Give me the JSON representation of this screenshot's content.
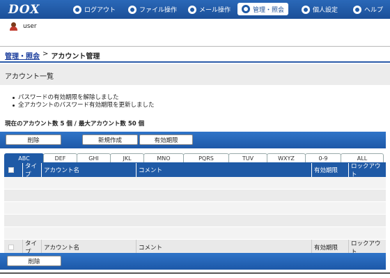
{
  "app": {
    "logo": "DOX"
  },
  "nav": [
    {
      "label": "ログアウト",
      "icon": "logout-icon"
    },
    {
      "label": "ファイル操作",
      "icon": "file-icon"
    },
    {
      "label": "メール操作",
      "icon": "mail-icon"
    },
    {
      "label": "管理・照会",
      "icon": "admin-icon",
      "active": true
    },
    {
      "label": "個人設定",
      "icon": "user-settings-icon"
    },
    {
      "label": "ヘルプ",
      "icon": "help-icon"
    }
  ],
  "user": {
    "name": "user"
  },
  "breadcrumb": {
    "parent": "管理・照会",
    "separator": ">",
    "current": "アカウント管理"
  },
  "section": {
    "title": "アカウント一覧"
  },
  "messages": [
    "パスワードの有効期限を解除しました",
    "全アカウントのパスワード有効期限を更新しました"
  ],
  "count_text": "現在のアカウント数 5 個 / 最大アカウント数 50 個",
  "toolbar": {
    "delete": "削除",
    "create": "新規作成",
    "expire": "有効期限"
  },
  "tabs": [
    "ABC",
    "DEF",
    "GHI",
    "JKL",
    "MNO",
    "PQRS",
    "TUV",
    "WXYZ",
    "0-9",
    "ALL"
  ],
  "table": {
    "headers": {
      "type": "タイプ",
      "account": "アカウント名",
      "comment": "コメント",
      "expiry": "有効期限",
      "lockout": "ロックアウト"
    }
  },
  "colors": {
    "primary": "#1f5aa6",
    "active_tab": "#1f5aa6"
  }
}
